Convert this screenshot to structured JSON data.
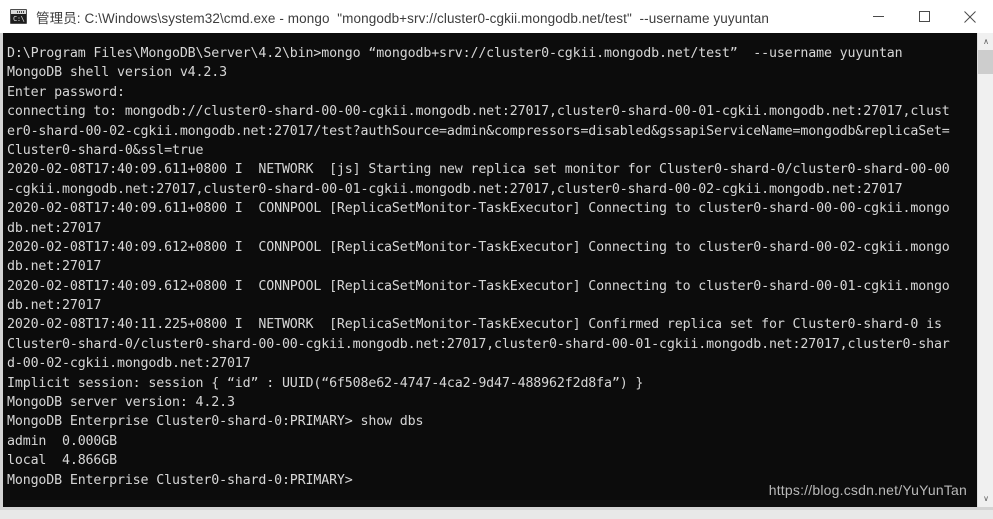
{
  "window": {
    "title": "管理员: C:\\Windows\\system32\\cmd.exe - mongo  \"mongodb+srv://cluster0-cgkii.mongodb.net/test\"  --username yuyuntan",
    "icon": "console-icon",
    "icon_glyph": "C:\\",
    "minimize_label": "Minimize",
    "maximize_label": "Maximize",
    "close_label": "Close"
  },
  "scrollbar": {
    "up_arrow": "∧",
    "down_arrow": "∨"
  },
  "terminal": {
    "lines": [
      "D:\\Program Files\\MongoDB\\Server\\4.2\\bin>mongo “mongodb+srv://cluster0-cgkii.mongodb.net/test”  --username yuyuntan",
      "MongoDB shell version v4.2.3",
      "Enter password:",
      "connecting to: mongodb://cluster0-shard-00-00-cgkii.mongodb.net:27017,cluster0-shard-00-01-cgkii.mongodb.net:27017,clust",
      "er0-shard-00-02-cgkii.mongodb.net:27017/test?authSource=admin&compressors=disabled&gssapiServiceName=mongodb&replicaSet=",
      "Cluster0-shard-0&ssl=true",
      "2020-02-08T17:40:09.611+0800 I  NETWORK  [js] Starting new replica set monitor for Cluster0-shard-0/cluster0-shard-00-00",
      "-cgkii.mongodb.net:27017,cluster0-shard-00-01-cgkii.mongodb.net:27017,cluster0-shard-00-02-cgkii.mongodb.net:27017",
      "2020-02-08T17:40:09.611+0800 I  CONNPOOL [ReplicaSetMonitor-TaskExecutor] Connecting to cluster0-shard-00-00-cgkii.mongo",
      "db.net:27017",
      "2020-02-08T17:40:09.612+0800 I  CONNPOOL [ReplicaSetMonitor-TaskExecutor] Connecting to cluster0-shard-00-02-cgkii.mongo",
      "db.net:27017",
      "2020-02-08T17:40:09.612+0800 I  CONNPOOL [ReplicaSetMonitor-TaskExecutor] Connecting to cluster0-shard-00-01-cgkii.mongo",
      "db.net:27017",
      "2020-02-08T17:40:11.225+0800 I  NETWORK  [ReplicaSetMonitor-TaskExecutor] Confirmed replica set for Cluster0-shard-0 is ",
      "Cluster0-shard-0/cluster0-shard-00-00-cgkii.mongodb.net:27017,cluster0-shard-00-01-cgkii.mongodb.net:27017,cluster0-shar",
      "d-00-02-cgkii.mongodb.net:27017",
      "Implicit session: session { “id” : UUID(“6f508e62-4747-4ca2-9d47-488962f2d8fa”) }",
      "MongoDB server version: 4.2.3",
      "MongoDB Enterprise Cluster0-shard-0:PRIMARY> show dbs",
      "admin  0.000GB",
      "local  4.866GB",
      "MongoDB Enterprise Cluster0-shard-0:PRIMARY>"
    ]
  },
  "watermark": {
    "text": "https://blog.csdn.net/YuYunTan"
  },
  "colors": {
    "terminal_bg": "#0c0c0c",
    "terminal_fg": "#d6d6d6",
    "titlebar_bg": "#ffffff",
    "title_fg": "#3d3d3d",
    "scrollbar_track": "#f0f0f0",
    "scrollbar_thumb": "#cdcdcd",
    "desktop": "#d9d9d9"
  }
}
